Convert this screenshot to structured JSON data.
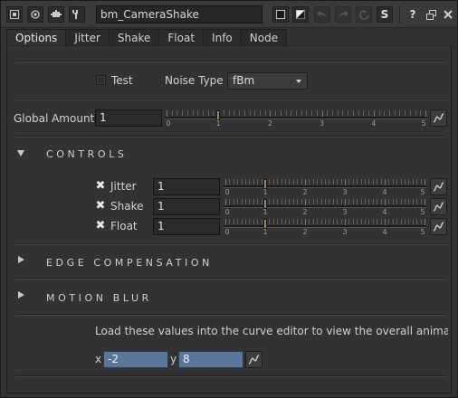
{
  "node": {
    "name": "bm_CameraShake"
  },
  "toolbar": {
    "icons": [
      "expand-icon",
      "center-icon",
      "node-icon",
      "wrench-icon",
      "color-swatch-icon",
      "color-swatch-alt-icon",
      "undo-icon",
      "redo-icon",
      "revert-icon",
      "script-icon",
      "help-icon",
      "float-icon",
      "close-icon"
    ],
    "script_label": "S",
    "help_label": "?"
  },
  "tabs": [
    {
      "label": "Options",
      "active": true
    },
    {
      "label": "Jitter",
      "active": false
    },
    {
      "label": "Shake",
      "active": false
    },
    {
      "label": "Float",
      "active": false
    },
    {
      "label": "Info",
      "active": false
    },
    {
      "label": "Node",
      "active": false
    }
  ],
  "options": {
    "test_label": "Test",
    "test_checked": false,
    "noise_type_label": "Noise Type",
    "noise_type_value": "fBm"
  },
  "global_amount": {
    "label": "Global Amount",
    "value": "1",
    "slider_ticks": [
      "0",
      "1",
      "2",
      "3",
      "4",
      "5"
    ],
    "slider_value": 1
  },
  "sections": {
    "controls": "CONTROLS",
    "edge_compensation": "EDGE COMPENSATION",
    "motion_blur": "MOTION BLUR"
  },
  "controls": [
    {
      "label": "Jitter",
      "checked": true,
      "value": "1",
      "slider_value": 1
    },
    {
      "label": "Shake",
      "checked": true,
      "value": "1",
      "slider_value": 1
    },
    {
      "label": "Float",
      "checked": true,
      "value": "1",
      "slider_value": 1
    }
  ],
  "curve_note": "Load these values into the curve editor to view the overall animation",
  "xy": {
    "x_label": "x",
    "x_value": "-2",
    "y_label": "y",
    "y_value": "8"
  },
  "colors": {
    "field_blue": "#5a7799",
    "slider_handle": "#a0875a",
    "panel_bg": "#323232"
  }
}
